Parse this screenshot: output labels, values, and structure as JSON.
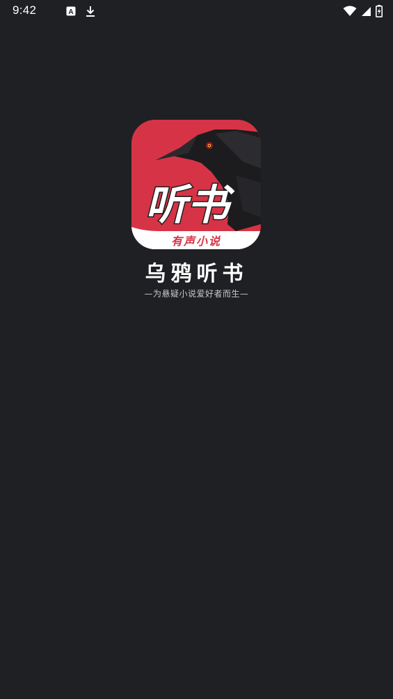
{
  "status_bar": {
    "time": "9:42",
    "left_icons": [
      "translate-notification-icon",
      "download-icon"
    ],
    "right_icons": [
      "wifi-icon",
      "cell-signal-icon",
      "battery-charging-icon"
    ]
  },
  "splash": {
    "logo": {
      "title_text": "听书",
      "banner_text": "有声小说",
      "background_color": "#d63446",
      "banner_color": "#ffffff"
    },
    "app_name": "乌鸦听书",
    "slogan": "—为悬疑小说爱好者而生—"
  },
  "colors": {
    "background": "#1f2023",
    "accent": "#d63446"
  }
}
